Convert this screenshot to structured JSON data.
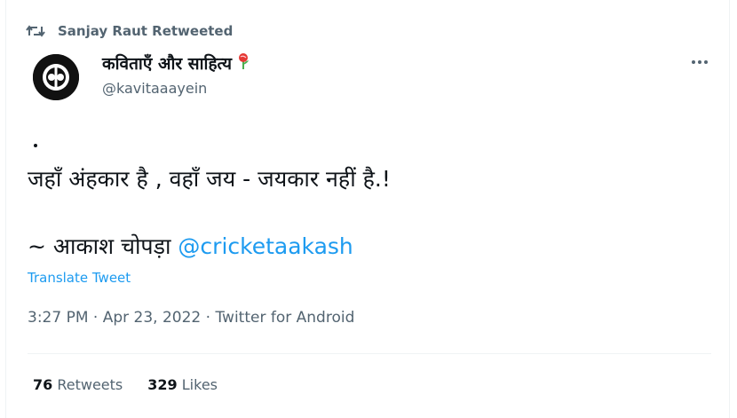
{
  "retweet_context": {
    "label": "Sanjay Raut Retweeted",
    "icon": "retweet-icon"
  },
  "author": {
    "display_name": "कविताएँ और साहित्य",
    "emoji_icon": "lollipop-rose-icon",
    "handle": "@kavitaaayein",
    "avatar_icon": "kavita-logo-avatar"
  },
  "tweet": {
    "line1": "जहाँ अंहकार है , वहाँ जय - जयकार नहीं है.!",
    "line2_prefix": "~ आकाश चोपड़ा",
    "line2_mention": "@cricketaakash",
    "translate_label": "Translate Tweet"
  },
  "meta": {
    "time": "3:27 PM",
    "sep1": " · ",
    "date": "Apr 23, 2022",
    "sep2": " · ",
    "source": "Twitter for Android"
  },
  "stats": {
    "retweets_count": "76",
    "retweets_label": "Retweets",
    "likes_count": "329",
    "likes_label": "Likes"
  },
  "colors": {
    "accent": "#1d9bf0",
    "secondary_text": "#536471",
    "primary_text": "#0f1419"
  }
}
